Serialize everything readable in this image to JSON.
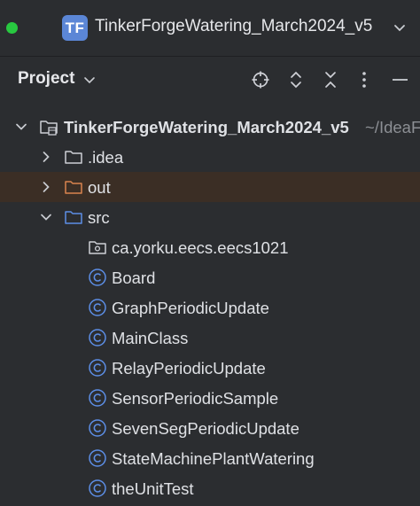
{
  "window": {
    "badge": "TF",
    "title": "TinkerForgeWatering_March2024_v5"
  },
  "panel": {
    "title": "Project"
  },
  "tree": {
    "root": {
      "label": "TinkerForgeWatering_March2024_v5",
      "path": "~/IdeaF"
    },
    "idea": {
      "label": ".idea"
    },
    "out": {
      "label": "out"
    },
    "src": {
      "label": "src"
    },
    "package": {
      "label": "ca.yorku.eecs.eecs1021"
    },
    "classes": [
      "Board",
      "GraphPeriodicUpdate",
      "MainClass",
      "RelayPeriodicUpdate",
      "SensorPeriodicSample",
      "SevenSegPeriodicUpdate",
      "StateMachinePlantWatering",
      "theUnitTest"
    ]
  },
  "colors": {
    "background": "#2b2d30",
    "selection": "#3b2e25",
    "badge": "#5b86d6",
    "class_icon": "#5c8ee6",
    "excluded_folder": "#d9844f",
    "source_folder": "#5c8ee6"
  },
  "icons": {
    "locate": "crosshair-icon",
    "expand": "expand-all-icon",
    "collapse": "collapse-all-icon",
    "options": "more-vertical-icon",
    "hide": "minimize-icon"
  }
}
